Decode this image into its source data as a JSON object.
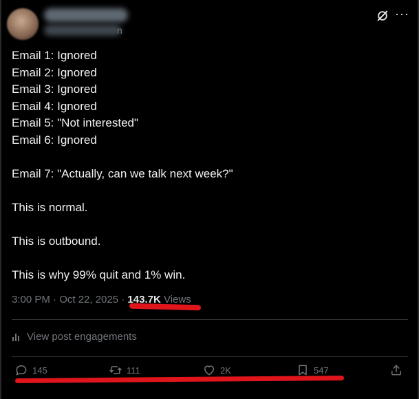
{
  "author": {
    "handle_tail": "n"
  },
  "post": {
    "lines": [
      "Email 1: Ignored",
      "Email 2: Ignored",
      "Email 3: Ignored",
      "Email 4: Ignored",
      "Email 5: \"Not interested\"",
      "Email 6: Ignored",
      "",
      "Email 7: \"Actually, can we talk next week?\"",
      "",
      "This is normal.",
      "",
      "This is outbound.",
      "",
      "This is why 99% quit and 1% win."
    ],
    "timestamp": "3:00 PM · Oct 22, 2025 · ",
    "views_count": "143.7K",
    "views_label": " Views",
    "engagements_label": "View post engagements"
  },
  "actions": {
    "replies": "145",
    "reposts": "111",
    "likes": "2K",
    "bookmarks": "547"
  },
  "colors": {
    "background": "#000000",
    "text": "#e7e9ea",
    "muted": "#71767b",
    "highlight_marker": "#e0151b"
  },
  "icons": [
    "grok-icon",
    "more-icon",
    "bars-icon",
    "reply-icon",
    "repost-icon",
    "like-icon",
    "bookmark-icon",
    "share-icon"
  ]
}
